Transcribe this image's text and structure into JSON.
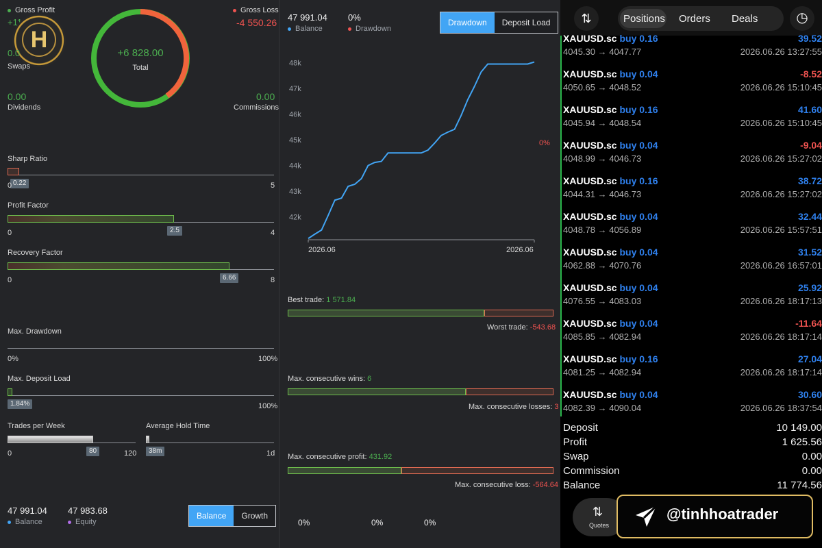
{
  "summary": {
    "gross_profit_label": "Gross Profit",
    "gross_profit_value": "+11",
    "gross_loss_label": "Gross Loss",
    "gross_loss_value": "-4 550.26",
    "swaps_value": "0.0",
    "swaps_label": "Swaps",
    "total_value": "+6 828.00",
    "total_label": "Total",
    "dividends_value": "0.00",
    "dividends_label": "Dividends",
    "commissions_value": "0.00",
    "commissions_label": "Commissions"
  },
  "metrics": {
    "sharp": {
      "label": "Sharp Ratio",
      "value": "0.22",
      "min": "0",
      "max": "5",
      "fill": 0.044
    },
    "profit_factor": {
      "label": "Profit Factor",
      "value": "2.5",
      "min": "0",
      "max": "4",
      "fill": 0.625
    },
    "recovery_factor": {
      "label": "Recovery Factor",
      "value": "6.66",
      "min": "0",
      "max": "8",
      "fill": 0.8325
    },
    "max_drawdown": {
      "label": "Max. Drawdown",
      "min": "0%",
      "max": "100%"
    },
    "max_deposit_load": {
      "label": "Max. Deposit Load",
      "value": "1.84%",
      "max": "100%",
      "fill": 0.0184
    },
    "trades_per_week": {
      "label": "Trades per Week",
      "value": "80",
      "min": "0",
      "max": "120",
      "fill": 0.667
    },
    "average_hold_time": {
      "label": "Average Hold Time",
      "value": "38m",
      "max": "1d",
      "fill": 0.026
    }
  },
  "bottom_left": {
    "balance_value": "47 991.04",
    "balance_label": "Balance",
    "equity_value": "47 983.68",
    "equity_label": "Equity",
    "buttons": [
      "Balance",
      "Growth"
    ]
  },
  "chart_header": {
    "balance_value": "47 991.04",
    "balance_label": "Balance",
    "drawdown_value": "0%",
    "drawdown_label": "Drawdown",
    "buttons": [
      "Drawdown",
      "Deposit Load"
    ],
    "drawdown_marker": "0%"
  },
  "chart_data": {
    "type": "line",
    "y_ticks": [
      "48k",
      "47k",
      "46k",
      "45k",
      "44k",
      "43k",
      "42k"
    ],
    "x_ticks": [
      "2026.06",
      "2026.06"
    ],
    "ylim": [
      41100,
      48300
    ],
    "series": [
      {
        "values": [
          41150,
          41320,
          41480,
          42050,
          42640,
          42720,
          43180,
          43260,
          43480,
          43990,
          44110,
          44150,
          44480,
          44480,
          44480,
          44480,
          44480,
          44480,
          44590,
          44860,
          45160,
          45290,
          45400,
          45940,
          46560,
          47070,
          47630,
          47940,
          47940,
          47940,
          47940,
          47940,
          47940,
          47940,
          48020
        ]
      }
    ],
    "grid": false,
    "legend": "top-left"
  },
  "trade_stats": {
    "best_trade_label": "Best trade:",
    "best_trade_value": "1 571.84",
    "worst_trade_label": "Worst trade:",
    "worst_trade_value": "-543.68",
    "max_wins_label": "Max. consecutive wins:",
    "max_wins_value": "6",
    "max_losses_label": "Max. consecutive losses:",
    "max_losses_value": "3",
    "max_profit_label": "Max. consecutive profit:",
    "max_profit_value": "431.92",
    "max_loss_label": "Max. consecutive loss:",
    "max_loss_value": "-564.64"
  },
  "bottom_mid": [
    "0%",
    "0%",
    "0%"
  ],
  "right": {
    "tabs": [
      "Positions",
      "Orders",
      "Deals"
    ],
    "deals": [
      {
        "symbol": "XAUUSD.sc",
        "side": "buy 0.16",
        "prices": "4045.30 → 4047.77",
        "profit": "39.52",
        "time": "2026.06.26 13:27:55",
        "positive": true
      },
      {
        "symbol": "XAUUSD.sc",
        "side": "buy 0.04",
        "prices": "4050.65 → 4048.52",
        "profit": "-8.52",
        "time": "2026.06.26 15:10:45",
        "positive": false
      },
      {
        "symbol": "XAUUSD.sc",
        "side": "buy 0.16",
        "prices": "4045.94 → 4048.54",
        "profit": "41.60",
        "time": "2026.06.26 15:10:45",
        "positive": true
      },
      {
        "symbol": "XAUUSD.sc",
        "side": "buy 0.04",
        "prices": "4048.99 → 4046.73",
        "profit": "-9.04",
        "time": "2026.06.26 15:27:02",
        "positive": false
      },
      {
        "symbol": "XAUUSD.sc",
        "side": "buy 0.16",
        "prices": "4044.31 → 4046.73",
        "profit": "38.72",
        "time": "2026.06.26 15:27:02",
        "positive": true
      },
      {
        "symbol": "XAUUSD.sc",
        "side": "buy 0.04",
        "prices": "4048.78 → 4056.89",
        "profit": "32.44",
        "time": "2026.06.26 15:57:51",
        "positive": true
      },
      {
        "symbol": "XAUUSD.sc",
        "side": "buy 0.04",
        "prices": "4062.88 → 4070.76",
        "profit": "31.52",
        "time": "2026.06.26 16:57:01",
        "positive": true
      },
      {
        "symbol": "XAUUSD.sc",
        "side": "buy 0.04",
        "prices": "4076.55 → 4083.03",
        "profit": "25.92",
        "time": "2026.06.26 18:17:13",
        "positive": true
      },
      {
        "symbol": "XAUUSD.sc",
        "side": "buy 0.04",
        "prices": "4085.85 → 4082.94",
        "profit": "-11.64",
        "time": "2026.06.26 18:17:14",
        "positive": false
      },
      {
        "symbol": "XAUUSD.sc",
        "side": "buy 0.16",
        "prices": "4081.25 → 4082.94",
        "profit": "27.04",
        "time": "2026.06.26 18:17:14",
        "positive": true
      },
      {
        "symbol": "XAUUSD.sc",
        "side": "buy 0.04",
        "prices": "4082.39 → 4090.04",
        "profit": "30.60",
        "time": "2026.06.26 18:37:54",
        "positive": true
      }
    ],
    "summary": [
      {
        "label": "Deposit",
        "value": "10 149.00"
      },
      {
        "label": "Profit",
        "value": "1 625.56"
      },
      {
        "label": "Swap",
        "value": "0.00"
      },
      {
        "label": "Commission",
        "value": "0.00"
      },
      {
        "label": "Balance",
        "value": "11 774.56"
      }
    ],
    "quotes_label": "Quotes",
    "watermark": "@tinhhoatrader"
  },
  "colors": {
    "green": "#4caf50",
    "red": "#ef5350",
    "blue": "#42a5f5",
    "buy_blue": "#2f80ed"
  }
}
